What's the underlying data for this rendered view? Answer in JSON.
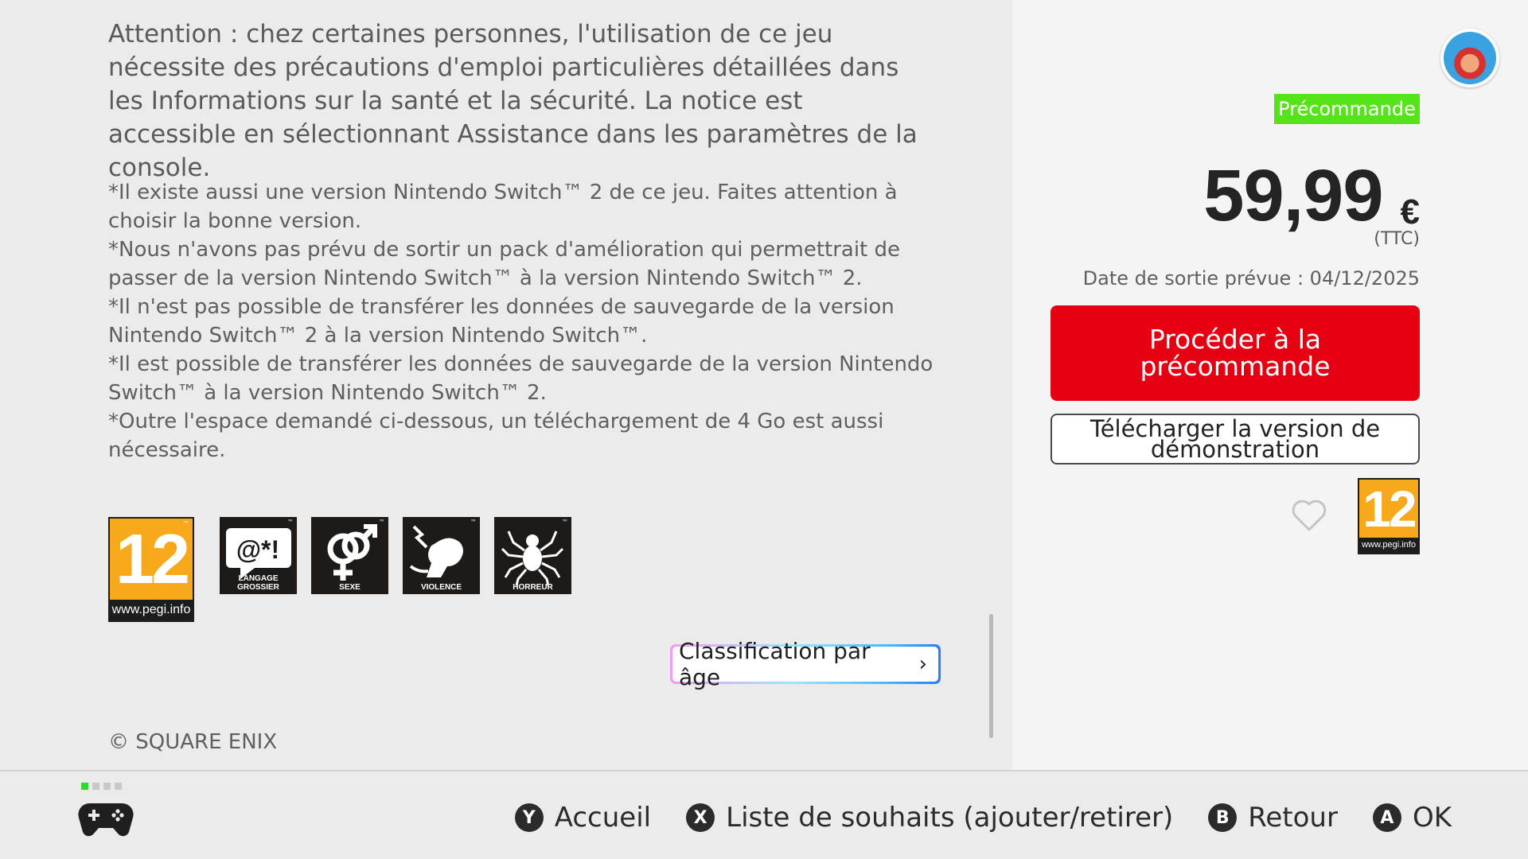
{
  "main": {
    "warning": "Attention : chez certaines personnes, l'utilisation de ce jeu nécessite des précautions d'emploi particulières détaillées dans les Informations sur la santé et la sécurité. La notice est accessible en sélectionnant Assistance dans les paramètres de la console.",
    "notes": [
      "*Il existe aussi une version Nintendo Switch™ 2 de ce jeu. Faites attention à choisir la bonne version.",
      "*Nous n'avons pas prévu de sortir un pack d'amélioration qui permettrait de passer de la version Nintendo Switch™ à la version Nintendo Switch™ 2.",
      "*Il n'est pas possible de transférer les données de sauvegarde de la version Nintendo Switch™ 2 à la version Nintendo Switch™.",
      "*Il est possible de transférer les données de sauvegarde de la version Nintendo Switch™ à la version Nintendo Switch™ 2.",
      "*Outre l'espace demandé ci-dessous, un téléchargement de 4 Go est aussi nécessaire."
    ],
    "pegi": {
      "age": "12",
      "url": "www.pegi.info"
    },
    "descriptors": [
      {
        "label": "LANGAGE GROSSIER",
        "icon": "bad-language-icon"
      },
      {
        "label": "SEXE",
        "icon": "sex-icon"
      },
      {
        "label": "VIOLENCE",
        "icon": "violence-icon"
      },
      {
        "label": "HORREUR",
        "icon": "fear-icon"
      }
    ],
    "classification_button": "Classification par âge",
    "copyright": "© SQUARE ENIX"
  },
  "side": {
    "badge": "Précommande",
    "price": "59,99",
    "currency": "€",
    "ttc": "(TTC)",
    "release": "Date de sortie prévue : 04/12/2025",
    "preorder_button": "Procéder à la précommande",
    "demo_button": "Télécharger la version de démonstration",
    "pegi": {
      "age": "12",
      "url": "www.pegi.info"
    }
  },
  "footer": {
    "hints": [
      {
        "button": "Y",
        "label": "Accueil"
      },
      {
        "button": "X",
        "label": "Liste de souhaits (ajouter/retirer)"
      },
      {
        "button": "B",
        "label": "Retour"
      },
      {
        "button": "A",
        "label": "OK"
      }
    ]
  },
  "colors": {
    "accent_red": "#e60012",
    "badge_green": "#55e41a",
    "pegi_orange": "#f7a81b"
  }
}
